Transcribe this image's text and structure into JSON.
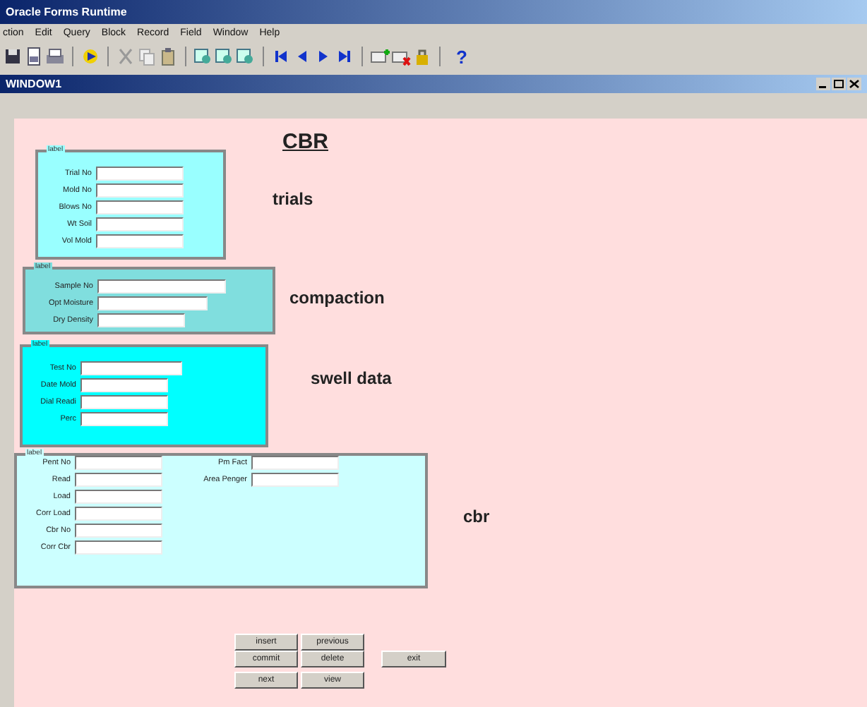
{
  "app_title": "Oracle Forms Runtime",
  "menu": [
    "ction",
    "Edit",
    "Query",
    "Block",
    "Record",
    "Field",
    "Window",
    "Help"
  ],
  "toolbar": {
    "help": "?"
  },
  "window": {
    "title": "WINDOW1"
  },
  "form_title": "CBR",
  "frames": [
    {
      "caption": "label",
      "title": "trials",
      "fields": [
        "Trial No",
        "Mold No",
        "Blows No",
        "Wt Soil",
        "Vol Mold"
      ]
    },
    {
      "caption": "label",
      "title": "compaction",
      "fields": [
        "Sample No",
        "Opt Moisture",
        "Dry Density"
      ]
    },
    {
      "caption": "label",
      "title": "swell data",
      "fields": [
        "Test No",
        "Date Mold",
        "Dial Readi",
        "Perc"
      ]
    },
    {
      "caption": "label",
      "title": "cbr",
      "fields": [
        "Pent No",
        "Read",
        "Load",
        "Corr Load",
        "Cbr No",
        "Corr Cbr"
      ],
      "side_fields": [
        "Pm Fact",
        "Area Penger"
      ]
    }
  ],
  "buttons": [
    "insert",
    "previous",
    "commit",
    "delete",
    "next",
    "view"
  ],
  "exit_button": "exit"
}
